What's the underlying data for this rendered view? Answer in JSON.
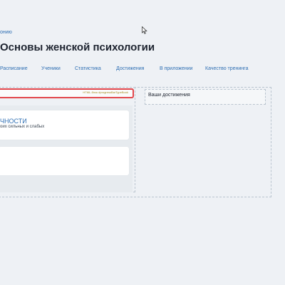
{
  "breadcrumb": {
    "text": "онию"
  },
  "page": {
    "title": "Основы женской психологии"
  },
  "tabs": [
    {
      "label": "Расписание"
    },
    {
      "label": "Ученики"
    },
    {
      "label": "Статистика"
    },
    {
      "label": "Достижения"
    },
    {
      "label": "В приложении"
    },
    {
      "label": "Качество тренинга"
    }
  ],
  "progress_bar": {
    "label": "HTML-блок #progressBarTypeBook"
  },
  "cards": [
    {
      "title": "ЧНОСТИ",
      "subtitle": "оих сильных и слабых"
    },
    {
      "title": "",
      "subtitle": ""
    }
  ],
  "achievements": {
    "title": "Ваши достижения"
  },
  "colors": {
    "accent": "#2f6fb3",
    "highlight": "#e2474c",
    "background": "#eef1f5"
  },
  "icons": {
    "cursor": "mouse-pointer-icon"
  }
}
